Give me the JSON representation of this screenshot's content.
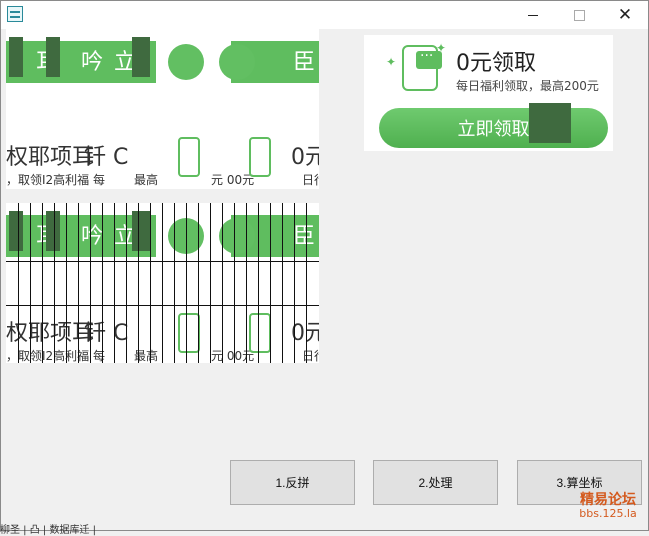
{
  "window": {
    "icon": "app-icon",
    "controls": {
      "minimize_icon": "minimize-icon",
      "maximize_icon": "maximize-icon",
      "close_glyph": "✕"
    }
  },
  "puzzle": {
    "strip_fragments": [
      "耳",
      "吟",
      "立",
      "臣"
    ],
    "glitch_line1": "权耶项耳",
    "glitch_line1b": "钎 C",
    "glitch_line1c": "0元",
    "glitch_line2": "，取领I2高利福 每",
    "glitch_line2b": "最高",
    "glitch_line2c": "元 00元",
    "glitch_line2d": "日行"
  },
  "ad": {
    "title": "0元领取",
    "subtitle": "每日福利领取，最高200元",
    "button_label": "立即领取",
    "accent_color": "#5fbd5f"
  },
  "buttons": {
    "reverse": "1.反拼",
    "process": "2.处理",
    "calc": "3.算坐标"
  },
  "watermark": {
    "name": "精易论坛",
    "url": "bbs.125.la"
  },
  "bottom_fragment": "柳圣 | 凸 | 数据库迁 |"
}
